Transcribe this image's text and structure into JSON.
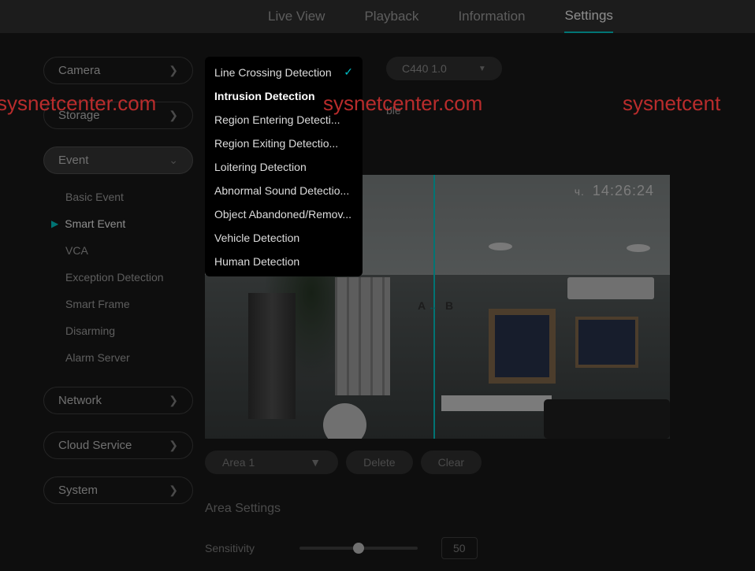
{
  "nav": {
    "live_view": "Live View",
    "playback": "Playback",
    "information": "Information",
    "settings": "Settings"
  },
  "sidebar": {
    "camera": "Camera",
    "storage": "Storage",
    "event": "Event",
    "network": "Network",
    "cloud_service": "Cloud Service",
    "system": "System",
    "event_items": {
      "basic_event": "Basic Event",
      "smart_event": "Smart Event",
      "vca": "VCA",
      "exception_detection": "Exception Detection",
      "smart_frame": "Smart Frame",
      "disarming": "Disarming",
      "alarm_server": "Alarm Server"
    }
  },
  "dropdown": {
    "items": [
      "Line Crossing Detection",
      "Intrusion Detection",
      "Region Entering Detecti...",
      "Region Exiting Detectio...",
      "Loitering Detection",
      "Abnormal Sound Detectio...",
      "Object Abandoned/Remov...",
      "Vehicle Detection",
      "Human Detection"
    ],
    "selected_index": 0,
    "highlight_index": 1
  },
  "channel": {
    "value": "C440 1.0"
  },
  "enable_label": "ble",
  "video": {
    "timestamp_prefix": "ч.",
    "timestamp": "14:26:24",
    "marker_a": "A",
    "marker_b": "B"
  },
  "controls": {
    "area": "Area 1",
    "delete": "Delete",
    "clear": "Clear"
  },
  "area_settings": "Area Settings",
  "sensitivity": {
    "label": "Sensitivity",
    "value": "50"
  },
  "watermark": "sysnetcenter.com",
  "watermark_partial": "sysnetcent"
}
